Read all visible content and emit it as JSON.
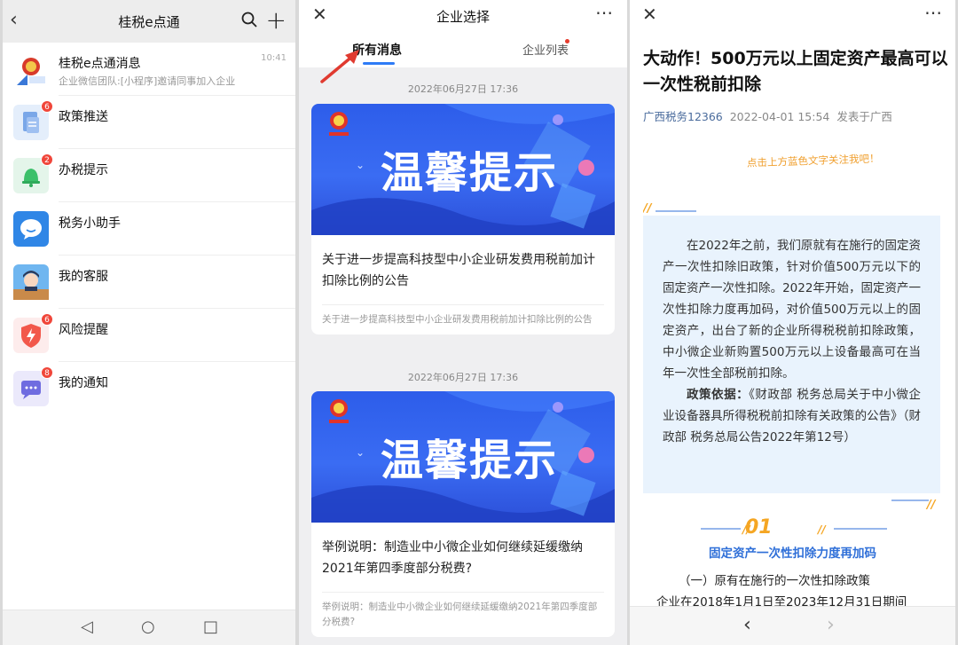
{
  "panel1": {
    "title": "桂税e点通",
    "items": [
      {
        "name": "桂税e点通消息",
        "sub": "企业微信团队:[小程序]邀请同事加入企业",
        "time": "10:41",
        "badge": ""
      },
      {
        "name": "政策推送",
        "sub": "",
        "time": "",
        "badge": "6"
      },
      {
        "name": "办税提示",
        "sub": "",
        "time": "",
        "badge": "2"
      },
      {
        "name": "税务小助手",
        "sub": "",
        "time": "",
        "badge": ""
      },
      {
        "name": "我的客服",
        "sub": "",
        "time": "",
        "badge": ""
      },
      {
        "name": "风险提醒",
        "sub": "",
        "time": "",
        "badge": "6"
      },
      {
        "name": "我的通知",
        "sub": "",
        "time": "",
        "badge": "8"
      }
    ]
  },
  "panel2": {
    "title": "企业选择",
    "tab_all": "所有消息",
    "tab_list": "企业列表",
    "cards": [
      {
        "date": "2022年06月27日 17:36",
        "banner": "温馨提示",
        "title": "关于进一步提高科技型中小企业研发费用税前加计扣除比例的公告",
        "sub": "关于进一步提高科技型中小企业研发费用税前加计扣除比例的公告"
      },
      {
        "date": "2022年06月27日 17:36",
        "banner": "温馨提示",
        "title": "举例说明：制造业中小微企业如何继续延缓缴纳2021年第四季度部分税费?",
        "sub": "举例说明：制造业中小微企业如何继续延缓缴纳2021年第四季度部分税费?"
      }
    ]
  },
  "panel3": {
    "title": "大动作！500万元以上固定资产最高可以一次性税前扣除",
    "account": "广西税务12366",
    "date": "2022-04-01 15:54",
    "location": "发表于广西",
    "follow_hint": "点击上方蓝色文字关注我吧！",
    "box_p1": "在2022年之前，我们原就有在施行的固定资产一次性扣除旧政策，针对价值500万元以下的固定资产一次性扣除。2022年开始，固定资产一次性扣除力度再加码，对价值500万元以上的固定资产，出台了新的企业所得税税前扣除政策，中小微企业新购置500万元以上设备最高可在当年一次性全部税前扣除。",
    "box_p2_label": "政策依据：",
    "box_p2": "《财政部 税务总局关于中小微企业设备器具所得税税前扣除有关政策的公告》（财政部 税务总局公告2022年第12号）",
    "section_num": "01",
    "section_title": "固定资产一次性扣除力度再加码",
    "para1": "（一）原有在施行的一次性扣除政策",
    "para2": "企业在2018年1月1日至2023年12月31日期间"
  }
}
